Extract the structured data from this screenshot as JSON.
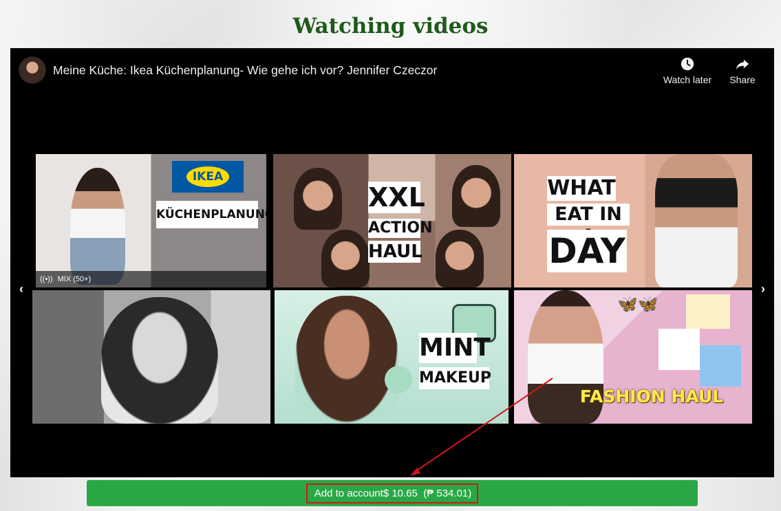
{
  "page": {
    "title": "Watching videos"
  },
  "player": {
    "video_title": "Meine Küche: Ikea Küchenplanung- Wie gehe ich vor? Jennifer Czeczor",
    "actions": [
      {
        "label": "Watch later",
        "icon": "clock-icon"
      },
      {
        "label": "Share",
        "icon": "share-arrow-icon"
      }
    ],
    "nav": {
      "prev_glyph": "‹",
      "next_glyph": "›"
    },
    "thumbnails": [
      {
        "caption": "KÜCHENPLANUNG",
        "logo": "IKEA",
        "badge": "MIX (50+)"
      },
      {
        "caption_lines": [
          "XXL",
          "ACTION",
          "HAUL"
        ]
      },
      {
        "caption_lines": [
          "WHAT I",
          "EAT IN A",
          "DAY"
        ]
      },
      {
        "caption": ""
      },
      {
        "caption_lines": [
          "MINT",
          "MAKEUP"
        ]
      },
      {
        "caption": "FASHION HAUL"
      }
    ]
  },
  "reward": {
    "label": "Add to account",
    "amount": "$ 10.65",
    "converted": "(₱ 534.01)"
  },
  "colors": {
    "title_green": "#1f5a1b",
    "button_green": "#29a745",
    "highlight_red": "#d0161a"
  }
}
